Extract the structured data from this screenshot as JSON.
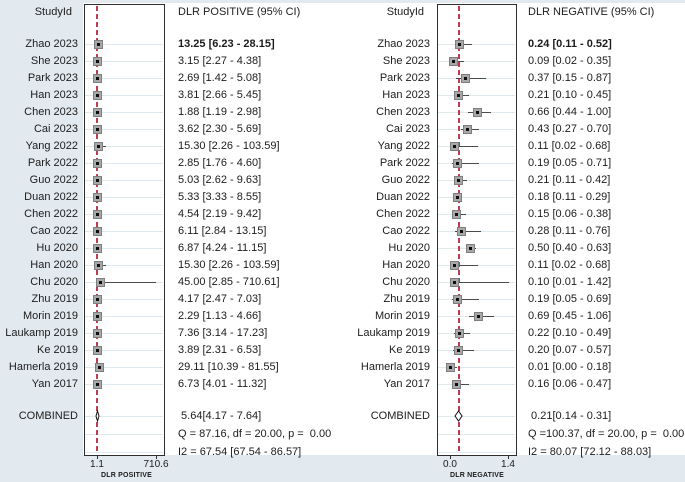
{
  "colors": {
    "canvas_bg": "#e2eaf0",
    "plot_bg": "#ffffff",
    "frame": "#2f2f2f",
    "gridline": "#dde9ec",
    "dashed_line": "#c13a50",
    "marker_fill": "#a8a8a8",
    "marker_dot": "#0d0d0d",
    "ci_line": "#4a4a4a",
    "text": "#1c1c1c"
  },
  "chart_data": [
    {
      "type": "forest",
      "panel": "dlr-positive",
      "studyid_header": "StudyId",
      "value_header": "DLR POSITIVE (95% CI)",
      "axis": {
        "scale": "linear",
        "min": 1.1,
        "max": 710.6,
        "min_label": "1.1",
        "max_label": "710.6",
        "title": "DLR POSITIVE"
      },
      "studies": [
        {
          "label": "Zhao 2023",
          "value": 13.25,
          "lo": 6.23,
          "hi": 28.15,
          "text": "13.25 [6.23 - 28.15]",
          "bold": true
        },
        {
          "label": "She 2023",
          "value": 3.15,
          "lo": 2.27,
          "hi": 4.38,
          "text": "3.15 [2.27 - 4.38]"
        },
        {
          "label": "Park 2023",
          "value": 2.69,
          "lo": 1.42,
          "hi": 5.08,
          "text": "2.69 [1.42 - 5.08]"
        },
        {
          "label": "Han 2023",
          "value": 3.81,
          "lo": 2.66,
          "hi": 5.45,
          "text": "3.81 [2.66 - 5.45]"
        },
        {
          "label": "Chen 2023",
          "value": 1.88,
          "lo": 1.19,
          "hi": 2.98,
          "text": "1.88 [1.19 - 2.98]"
        },
        {
          "label": "Cai 2023",
          "value": 3.62,
          "lo": 2.3,
          "hi": 5.69,
          "text": "3.62 [2.30 - 5.69]"
        },
        {
          "label": "Yang 2022",
          "value": 15.3,
          "lo": 2.26,
          "hi": 103.59,
          "text": "15.30 [2.26 - 103.59]"
        },
        {
          "label": "Park 2022",
          "value": 2.85,
          "lo": 1.76,
          "hi": 4.6,
          "text": "2.85 [1.76 - 4.60]"
        },
        {
          "label": "Guo 2022",
          "value": 5.03,
          "lo": 2.62,
          "hi": 9.63,
          "text": "5.03 [2.62 - 9.63]"
        },
        {
          "label": "Duan 2022",
          "value": 5.33,
          "lo": 3.33,
          "hi": 8.55,
          "text": "5.33 [3.33 - 8.55]"
        },
        {
          "label": "Chen 2022",
          "value": 4.54,
          "lo": 2.19,
          "hi": 9.42,
          "text": "4.54 [2.19 - 9.42]"
        },
        {
          "label": "Cao 2022",
          "value": 6.11,
          "lo": 2.84,
          "hi": 13.15,
          "text": "6.11 [2.84 - 13.15]"
        },
        {
          "label": "Hu 2020",
          "value": 6.87,
          "lo": 4.24,
          "hi": 11.15,
          "text": "6.87 [4.24 - 11.15]"
        },
        {
          "label": "Han 2020",
          "value": 15.3,
          "lo": 2.26,
          "hi": 103.59,
          "text": "15.30 [2.26 - 103.59]"
        },
        {
          "label": "Chu 2020",
          "value": 45.0,
          "lo": 2.85,
          "hi": 710.61,
          "text": "45.00 [2.85 - 710.61]"
        },
        {
          "label": "Zhu 2019",
          "value": 4.17,
          "lo": 2.47,
          "hi": 7.03,
          "text": "4.17 [2.47 - 7.03]"
        },
        {
          "label": "Morin 2019",
          "value": 2.29,
          "lo": 1.13,
          "hi": 4.66,
          "text": "2.29 [1.13 - 4.66]"
        },
        {
          "label": "Laukamp 2019",
          "value": 7.36,
          "lo": 3.14,
          "hi": 17.23,
          "text": "7.36 [3.14 - 17.23]"
        },
        {
          "label": "Ke 2019",
          "value": 3.89,
          "lo": 2.31,
          "hi": 6.53,
          "text": "3.89 [2.31 - 6.53]"
        },
        {
          "label": "Hamerla 2019",
          "value": 29.11,
          "lo": 10.39,
          "hi": 81.55,
          "text": "29.11 [10.39 - 81.55]"
        },
        {
          "label": "Yan 2017",
          "value": 6.73,
          "lo": 4.01,
          "hi": 11.32,
          "text": "6.73 [4.01 - 11.32]"
        }
      ],
      "combined": {
        "label": "COMBINED",
        "value": 5.64,
        "lo": 4.17,
        "hi": 7.64,
        "text": " 5.64[4.17 - 7.64]"
      },
      "stats": [
        "Q = 87.16, df = 20.00, p =  0.00",
        "I2 = 67.54 [67.54 - 86.57]"
      ]
    },
    {
      "type": "forest",
      "panel": "dlr-negative",
      "studyid_header": "StudyId",
      "value_header": "DLR NEGATIVE (95% CI)",
      "axis": {
        "scale": "linear",
        "min": 0.0,
        "max": 1.4,
        "min_label": "0.0",
        "max_label": "1.4",
        "title": "DLR NEGATIVE"
      },
      "studies": [
        {
          "label": "Zhao 2023",
          "value": 0.24,
          "lo": 0.11,
          "hi": 0.52,
          "text": "0.24 [0.11 - 0.52]",
          "bold": true
        },
        {
          "label": "She 2023",
          "value": 0.09,
          "lo": 0.02,
          "hi": 0.35,
          "text": "0.09 [0.02 - 0.35]"
        },
        {
          "label": "Park 2023",
          "value": 0.37,
          "lo": 0.15,
          "hi": 0.87,
          "text": "0.37 [0.15 - 0.87]"
        },
        {
          "label": "Han 2023",
          "value": 0.21,
          "lo": 0.1,
          "hi": 0.45,
          "text": "0.21 [0.10 - 0.45]"
        },
        {
          "label": "Chen 2023",
          "value": 0.66,
          "lo": 0.44,
          "hi": 1.0,
          "text": "0.66 [0.44 - 1.00]"
        },
        {
          "label": "Cai 2023",
          "value": 0.43,
          "lo": 0.27,
          "hi": 0.7,
          "text": "0.43 [0.27 - 0.70]"
        },
        {
          "label": "Yang 2022",
          "value": 0.11,
          "lo": 0.02,
          "hi": 0.68,
          "text": "0.11 [0.02 - 0.68]"
        },
        {
          "label": "Park 2022",
          "value": 0.19,
          "lo": 0.05,
          "hi": 0.71,
          "text": "0.19 [0.05 - 0.71]"
        },
        {
          "label": "Guo 2022",
          "value": 0.21,
          "lo": 0.11,
          "hi": 0.42,
          "text": "0.21 [0.11 - 0.42]"
        },
        {
          "label": "Duan 2022",
          "value": 0.18,
          "lo": 0.11,
          "hi": 0.29,
          "text": "0.18 [0.11 - 0.29]"
        },
        {
          "label": "Chen 2022",
          "value": 0.15,
          "lo": 0.06,
          "hi": 0.38,
          "text": "0.15 [0.06 - 0.38]"
        },
        {
          "label": "Cao 2022",
          "value": 0.28,
          "lo": 0.11,
          "hi": 0.76,
          "text": "0.28 [0.11 - 0.76]"
        },
        {
          "label": "Hu 2020",
          "value": 0.5,
          "lo": 0.4,
          "hi": 0.63,
          "text": "0.50 [0.40 - 0.63]"
        },
        {
          "label": "Han 2020",
          "value": 0.11,
          "lo": 0.02,
          "hi": 0.68,
          "text": "0.11 [0.02 - 0.68]"
        },
        {
          "label": "Chu 2020",
          "value": 0.1,
          "lo": 0.01,
          "hi": 1.42,
          "text": "0.10 [0.01 - 1.42]"
        },
        {
          "label": "Zhu 2019",
          "value": 0.19,
          "lo": 0.05,
          "hi": 0.69,
          "text": "0.19 [0.05 - 0.69]"
        },
        {
          "label": "Morin 2019",
          "value": 0.69,
          "lo": 0.45,
          "hi": 1.06,
          "text": "0.69 [0.45 - 1.06]"
        },
        {
          "label": "Laukamp 2019",
          "value": 0.22,
          "lo": 0.1,
          "hi": 0.49,
          "text": "0.22 [0.10 - 0.49]"
        },
        {
          "label": "Ke 2019",
          "value": 0.2,
          "lo": 0.07,
          "hi": 0.57,
          "text": "0.20 [0.07 - 0.57]"
        },
        {
          "label": "Hamerla 2019",
          "value": 0.01,
          "lo": 0.0,
          "hi": 0.18,
          "text": "0.01 [0.00 - 0.18]"
        },
        {
          "label": "Yan 2017",
          "value": 0.16,
          "lo": 0.06,
          "hi": 0.47,
          "text": "0.16 [0.06 - 0.47]"
        }
      ],
      "combined": {
        "label": "COMBINED",
        "value": 0.21,
        "lo": 0.14,
        "hi": 0.31,
        "text": " 0.21[0.14 - 0.31]"
      },
      "stats": [
        "Q =100.37, df = 20.00, p =  0.00",
        "I2 = 80.07 [72.12 - 88.03]"
      ]
    }
  ]
}
